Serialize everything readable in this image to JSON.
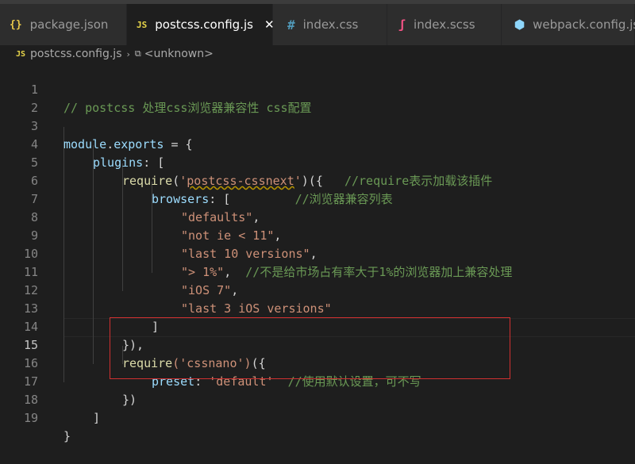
{
  "title_strip": "...",
  "tabs": [
    {
      "label": "package.json",
      "icon": "json-file-icon",
      "glyph": "{}"
    },
    {
      "label": "postcss.config.js",
      "icon": "js-file-icon",
      "glyph": "JS",
      "active": true,
      "close": "✕"
    },
    {
      "label": "index.css",
      "icon": "css-file-icon",
      "glyph": "#"
    },
    {
      "label": "index.scss",
      "icon": "scss-file-icon",
      "glyph": "ʃ"
    },
    {
      "label": "webpack.config.js",
      "icon": "webpack-file-icon",
      "glyph": "⬢"
    }
  ],
  "breadcrumb": {
    "file_glyph": "JS",
    "file": "postcss.config.js",
    "separator": "›",
    "symbol_glyph": "⧉",
    "symbol": "<unknown>"
  },
  "editor": {
    "current_line": 15,
    "lines": [
      {
        "n": "1"
      },
      {
        "n": "2"
      },
      {
        "n": "3"
      },
      {
        "n": "4"
      },
      {
        "n": "5"
      },
      {
        "n": "6"
      },
      {
        "n": "7"
      },
      {
        "n": "8"
      },
      {
        "n": "9"
      },
      {
        "n": "10"
      },
      {
        "n": "11"
      },
      {
        "n": "12"
      },
      {
        "n": "13"
      },
      {
        "n": "14"
      },
      {
        "n": "15"
      },
      {
        "n": "16"
      },
      {
        "n": "17"
      },
      {
        "n": "18"
      },
      {
        "n": "19"
      }
    ],
    "tokens": {
      "l1_comment": "// postcss 处理css浏览器兼容性 css配置",
      "l3_module": "module",
      "l3_dot": ".",
      "l3_exports": "exports",
      "l3_rest": " = {",
      "l4_plugins": "plugins",
      "l4_rest": ": [",
      "l5_require": "require",
      "l5_open": "(",
      "l5_q1": "'",
      "l5_name": "postcss-cssnext",
      "l5_q2": "'",
      "l5_close": ")({   ",
      "l5_comment": "//require表示加载该插件",
      "l6_browsers": "browsers",
      "l6_rest": ": [         ",
      "l6_comment": "//浏览器兼容列表",
      "l7_str": "\"defaults\"",
      "l7_pun": ",",
      "l8_str": "\"not ie < 11\"",
      "l8_pun": ",",
      "l9_str": "\"last 10 versions\"",
      "l9_pun": ",",
      "l10_str": "\"> 1%\"",
      "l10_pun": ",  ",
      "l10_comment": "//不是给市场占有率大于1%的浏览器加上兼容处理",
      "l11_str": "\"iOS 7\"",
      "l11_pun": ",",
      "l12_str": "\"last 3 iOS versions\"",
      "l13_pun": "]",
      "l14_pun": "}),",
      "l15_require": "require",
      "l15_str": "('cssnano')",
      "l15_rest": "({",
      "l16_preset": "preset",
      "l16_colon": ": ",
      "l16_str": "'default'",
      "l16_comment": "//使用默认设置，可不写",
      "l17_pun": "})",
      "l18_pun": "]",
      "l19_pun": "}"
    }
  },
  "colors": {
    "background": "#1e1e1e",
    "comment": "#6a9955",
    "string": "#ce9178",
    "property": "#9cdcfe",
    "function": "#dcdcaa",
    "highlight_box": "#d03030"
  }
}
